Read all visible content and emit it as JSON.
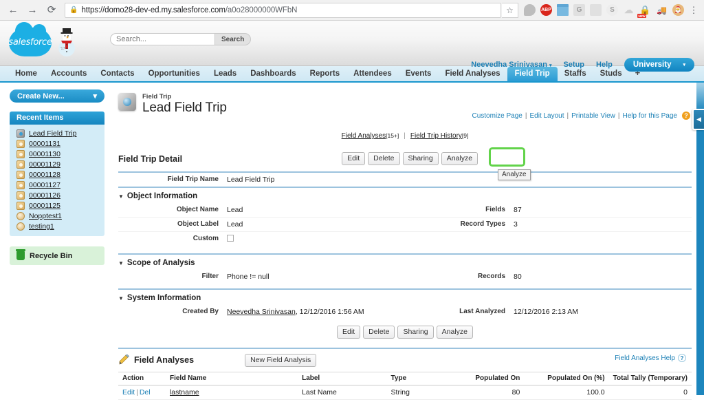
{
  "browser": {
    "back_icon": "←",
    "forward_icon": "→",
    "reload_icon": "⟳",
    "lock_icon": "🔒",
    "url_host": "https://domo28-dev-ed.my.salesforce.com",
    "url_path": "/a0o28000000WFbN",
    "star_icon": "☆",
    "extensions": [
      {
        "name": "balloon-extension-icon",
        "glyph": ""
      },
      {
        "name": "adblock-plus-icon",
        "glyph": "ABP"
      },
      {
        "name": "calendar-extension-icon",
        "glyph": ""
      },
      {
        "name": "grammarly-extension-icon",
        "glyph": "G"
      },
      {
        "name": "pocket-extension-icon",
        "glyph": ""
      },
      {
        "name": "skype-extension-icon",
        "glyph": "S"
      },
      {
        "name": "cloud-extension-icon",
        "glyph": "☁"
      },
      {
        "name": "new-extension-icon",
        "glyph": "🔒",
        "badge": "NEW"
      },
      {
        "name": "cart-extension-icon",
        "glyph": "🚚"
      },
      {
        "name": "santa-extension-icon",
        "glyph": "🎅"
      }
    ],
    "menu_icon": "⋮"
  },
  "header": {
    "logo_text": "salesforce",
    "search_placeholder": "Search...",
    "search_value": "",
    "search_button": "Search",
    "user_name": "Neevedha Srinivasan",
    "setup_link": "Setup",
    "help_link": "Help",
    "app_menu": "University",
    "caret": "▾"
  },
  "tabs": [
    {
      "label": "Home",
      "active": false
    },
    {
      "label": "Accounts",
      "active": false
    },
    {
      "label": "Contacts",
      "active": false
    },
    {
      "label": "Opportunities",
      "active": false
    },
    {
      "label": "Leads",
      "active": false
    },
    {
      "label": "Dashboards",
      "active": false
    },
    {
      "label": "Reports",
      "active": false
    },
    {
      "label": "Attendees",
      "active": false
    },
    {
      "label": "Events",
      "active": false
    },
    {
      "label": "Field Analyses",
      "active": false
    },
    {
      "label": "Field Trip",
      "active": true
    },
    {
      "label": "Staffs",
      "active": false
    },
    {
      "label": "Studs",
      "active": false
    },
    {
      "label": "+",
      "active": false
    }
  ],
  "sidebar": {
    "create_new": "Create New...",
    "create_new_caret": "▾",
    "recent_header": "Recent Items",
    "recent_items": [
      {
        "label": "Lead Field Trip",
        "icon": "trip-icon"
      },
      {
        "label": "00001131",
        "icon": "tape-icon"
      },
      {
        "label": "00001130",
        "icon": "tape-icon"
      },
      {
        "label": "00001129",
        "icon": "tape-icon"
      },
      {
        "label": "00001128",
        "icon": "tape-icon"
      },
      {
        "label": "00001127",
        "icon": "tape-icon"
      },
      {
        "label": "00001126",
        "icon": "tape-icon"
      },
      {
        "label": "00001125",
        "icon": "tape-icon"
      },
      {
        "label": "Nopptest1",
        "icon": "disc-icon"
      },
      {
        "label": "testing1",
        "icon": "disc-icon"
      }
    ],
    "recycle_bin": "Recycle Bin"
  },
  "record": {
    "type_label": "Field Trip",
    "title": "Lead Field Trip"
  },
  "page_links": {
    "customize_page": "Customize Page",
    "edit_layout": "Edit Layout",
    "printable_view": "Printable View",
    "help_for_page": "Help for this Page",
    "help_glyph": "?",
    "separator": "|"
  },
  "jump_links": {
    "field_analyses": "Field Analyses",
    "field_analyses_count": "[15+]",
    "field_trip_history": "Field Trip History",
    "field_trip_history_count": "[9]",
    "separator": "|"
  },
  "detail": {
    "title": "Field Trip Detail",
    "buttons": [
      "Edit",
      "Delete",
      "Sharing",
      "Analyze"
    ],
    "tooltip": "Analyze",
    "highlight_color": "#62d34a",
    "name_label": "Field Trip Name",
    "name_value": "Lead Field Trip"
  },
  "sections": {
    "object_information": {
      "title": "Object Information",
      "triangle": "▼",
      "rows": [
        {
          "label": "Object Name",
          "value": "Lead",
          "right_label": "Fields",
          "right_value": "87"
        },
        {
          "label": "Object Label",
          "value": "Lead",
          "right_label": "Record Types",
          "right_value": "3"
        },
        {
          "label": "Custom",
          "value": "",
          "right_label": "",
          "right_value": "",
          "checkbox": true
        }
      ]
    },
    "scope_of_analysis": {
      "title": "Scope of Analysis",
      "triangle": "▼",
      "rows": [
        {
          "label": "Filter",
          "value": "Phone != null",
          "right_label": "Records",
          "right_value": "80"
        }
      ]
    },
    "system_information": {
      "title": "System Information",
      "triangle": "▼",
      "rows": [
        {
          "label": "Created By",
          "value": "Neevedha Srinivasan",
          "value_suffix": ", 12/12/2016 1:56 AM",
          "right_label": "Last Analyzed",
          "right_value": "12/12/2016 2:13 AM"
        }
      ],
      "buttons": [
        "Edit",
        "Delete",
        "Sharing",
        "Analyze"
      ]
    }
  },
  "related_list": {
    "title": "Field Analyses",
    "new_button": "New Field Analysis",
    "help_link": "Field Analyses Help",
    "help_glyph": "?",
    "columns": [
      "Action",
      "Field Name",
      "Label",
      "Type",
      "Populated On",
      "Populated On (%)",
      "Total Tally (Temporary)"
    ],
    "rows": [
      {
        "action_edit": "Edit",
        "action_pipe": "|",
        "action_del": "Del",
        "field_name": "lastname",
        "label": "Last Name",
        "type": "String",
        "populated_on": "80",
        "populated_on_pct": "100.0",
        "total_tally": "0"
      }
    ]
  },
  "right_rail": {
    "collapse_icon": "◀"
  }
}
